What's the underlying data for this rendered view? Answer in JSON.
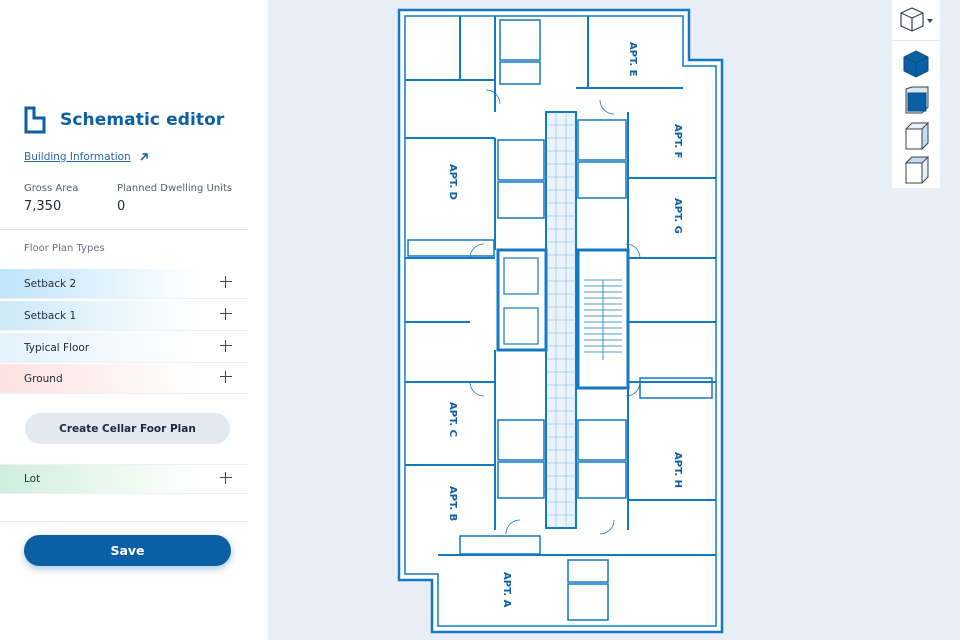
{
  "app": {
    "title": "Schematic editor"
  },
  "building": {
    "link_label": "Building Information",
    "gross_area_label": "Gross Area",
    "gross_area_value": "7,350",
    "dwelling_units_label": "Planned Dwelling Units",
    "dwelling_units_value": "0"
  },
  "floor_plans": {
    "section_label": "Floor Plan Types",
    "items": [
      {
        "label": "Setback 2",
        "color": "#bfe4fb"
      },
      {
        "label": "Setback 1",
        "color": "#cde8f7"
      },
      {
        "label": "Typical Floor",
        "color": "#e3f2fb"
      },
      {
        "label": "Ground",
        "color": "#fde1e1"
      }
    ],
    "cellar_button_label": "Create Cellar Foor Plan",
    "lot": {
      "label": "Lot",
      "color": "#cfeedd"
    }
  },
  "actions": {
    "save_label": "Save"
  },
  "plan": {
    "apartments": [
      "APT. E",
      "APT. F",
      "APT. D",
      "APT. G",
      "APT. C",
      "APT. H",
      "APT. B",
      "APT. A"
    ]
  },
  "view_toolbar": {
    "icons": [
      "cube-outline-icon",
      "cube-solid-icon",
      "cube-front-icon",
      "cube-side-icon",
      "cube-top-icon"
    ]
  },
  "colors": {
    "accent": "#0b5fa5",
    "plan_line": "#1479c4",
    "canvas": "#e8eef5"
  }
}
